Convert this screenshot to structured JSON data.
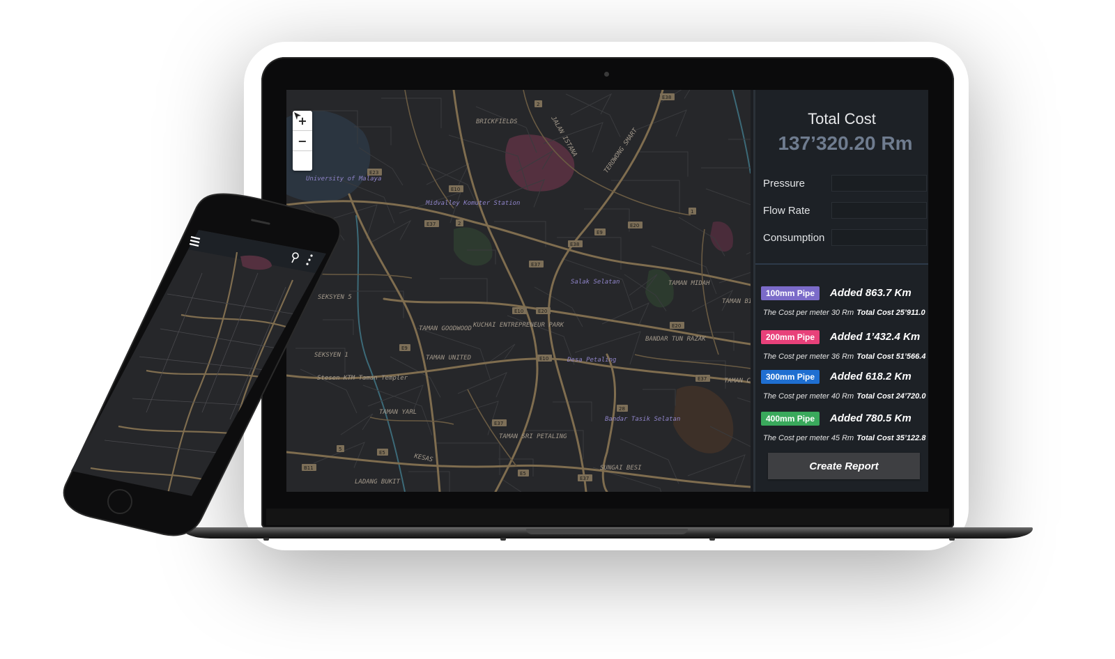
{
  "summary": {
    "title": "Total Cost",
    "value": "137’320.20 Rm"
  },
  "fields": [
    {
      "label": "Pressure",
      "value": ""
    },
    {
      "label": "Flow Rate",
      "value": ""
    },
    {
      "label": "Consumption",
      "value": ""
    }
  ],
  "pipes": [
    {
      "badge": "100mm Pipe",
      "color": "#7b6bc9",
      "added": "Added  863.7 Km",
      "cost_per_meter": "The Cost per meter 30 Rm",
      "total": "Total Cost 25’911.0"
    },
    {
      "badge": "200mm Pipe",
      "color": "#e8417a",
      "added": "Added 1’432.4 Km",
      "cost_per_meter": "The Cost per meter 36 Rm",
      "total": "Total Cost 51’566.4"
    },
    {
      "badge": "300mm Pipe",
      "color": "#1f6fd1",
      "added": "Added 618.2 Km",
      "cost_per_meter": "The Cost per meter 40 Rm",
      "total": "Total Cost 24’720.0"
    },
    {
      "badge": "400mm Pipe",
      "color": "#3aa95c",
      "added": "Added 780.5 Km",
      "cost_per_meter": "The Cost per meter 45 Rm",
      "total": "Total Cost 35’122.8"
    }
  ],
  "actions": {
    "create_report": "Create Report"
  },
  "map": {
    "zoom_in": "+",
    "zoom_out": "−",
    "labels": [
      {
        "text": "BRICKFIELDS"
      },
      {
        "text": "JALAN ISTANA"
      },
      {
        "text": "University of Malaya"
      },
      {
        "text": "Midvalley Komuter Station"
      },
      {
        "text": "SEKSYEN 5"
      },
      {
        "text": "TAMAN GOODWOOD"
      },
      {
        "text": "KUCHAI ENTREPRENEUR PARK"
      },
      {
        "text": "Salak Selatan"
      },
      {
        "text": "TAMAN MIDAH"
      },
      {
        "text": "BANDAR TUN RAZAK"
      },
      {
        "text": "SEKSYEN 1"
      },
      {
        "text": "TAMAN UNITED"
      },
      {
        "text": "Desa Petaling"
      },
      {
        "text": "Stesen KTM Taman Templer"
      },
      {
        "text": "TAMAN YARL"
      },
      {
        "text": "TAMAN SRI PETALING"
      },
      {
        "text": "Bandar Tasik Selatan"
      },
      {
        "text": "KESAS"
      },
      {
        "text": "LADANG BUKIT"
      },
      {
        "text": "SUNGAI BESI"
      },
      {
        "text": "TEROWONG SMART"
      },
      {
        "text": "TAMAN BILLION"
      },
      {
        "text": "TAMAN CONNAUGHT"
      }
    ],
    "road_shields": [
      "E38",
      "2",
      "E23",
      "E10",
      "E37",
      "2",
      "E38",
      "E9",
      "E20",
      "1",
      "E37",
      "E10",
      "E20",
      "E9",
      "E10",
      "E20",
      "E37",
      "5",
      "E5",
      "E37",
      "28",
      "B11",
      "E5",
      "E37"
    ]
  },
  "colors": {
    "panel_bg": "#1d2126",
    "map_bg": "#26272a",
    "road": "#8a7757",
    "accent_total": "#6f7c8f"
  },
  "icons": {
    "locate": "locate-arrow-icon",
    "menu": "hamburger-menu-icon",
    "search": "search-icon",
    "more": "more-vertical-icon"
  }
}
